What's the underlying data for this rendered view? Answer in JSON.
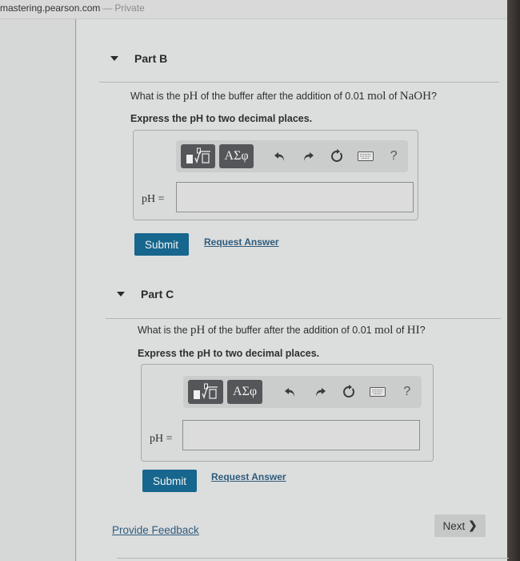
{
  "browser": {
    "host": "mastering.pearson.com",
    "separator": "—",
    "mode": "Private"
  },
  "parts": [
    {
      "title": "Part B",
      "question_prefix": "What is the ",
      "question_ph": "pH",
      "question_mid": " of the buffer after the addition of 0.01 ",
      "question_unit": "mol",
      "question_of": " of ",
      "question_species": "NaOH",
      "question_suffix": "?",
      "instruction": "Express the pH to two decimal places.",
      "toolbar": {
        "templates_icon": "templates-root-icon",
        "greek_label": "ΑΣφ",
        "undo_icon": "undo-icon",
        "redo_icon": "redo-icon",
        "reset_icon": "reset-icon",
        "keyboard_icon": "keyboard-icon",
        "help_label": "?"
      },
      "answer_label": "pH =",
      "answer_value": "",
      "submit_label": "Submit",
      "request_label": "Request Answer"
    },
    {
      "title": "Part C",
      "question_prefix": "What is the ",
      "question_ph": "pH",
      "question_mid": " of the buffer after the addition of 0.01 ",
      "question_unit": "mol",
      "question_of": " of ",
      "question_species": "HI",
      "question_suffix": "?",
      "instruction": "Express the pH to two decimal places.",
      "toolbar": {
        "templates_icon": "templates-root-icon",
        "greek_label": "ΑΣφ",
        "undo_icon": "undo-icon",
        "redo_icon": "redo-icon",
        "reset_icon": "reset-icon",
        "keyboard_icon": "keyboard-icon",
        "help_label": "?"
      },
      "answer_label": "pH =",
      "answer_value": "",
      "submit_label": "Submit",
      "request_label": "Request Answer"
    }
  ],
  "footer": {
    "feedback_label": "Provide Feedback",
    "next_label": "Next",
    "next_chevron": "❯"
  }
}
